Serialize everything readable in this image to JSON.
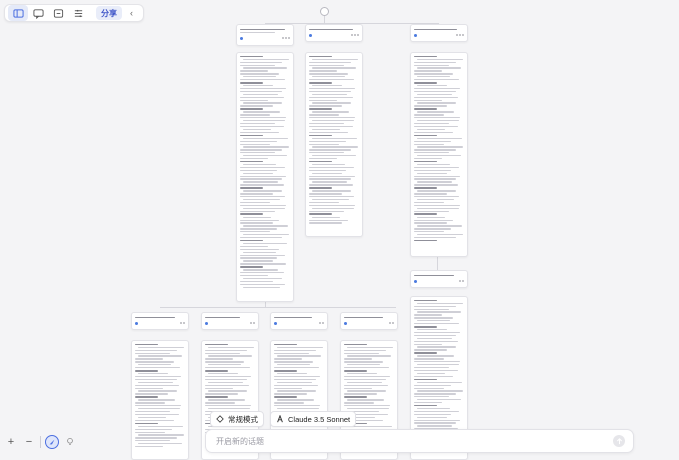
{
  "toolbar": {
    "share_label": "分享",
    "collapse_icon": "chevron-left-icon",
    "icons": [
      "sidebar-icon",
      "chat-bubble-icon",
      "message-icon",
      "list-settings-icon"
    ]
  },
  "composer": {
    "placeholder": "开启新的话题",
    "mode_label": "常规模式",
    "model_label": "Claude 3.5 Sonnet"
  },
  "colors": {
    "accent": "#4c6fe0",
    "share_bg": "#e9edf9",
    "canvas_bg": "#f4f4f6"
  }
}
